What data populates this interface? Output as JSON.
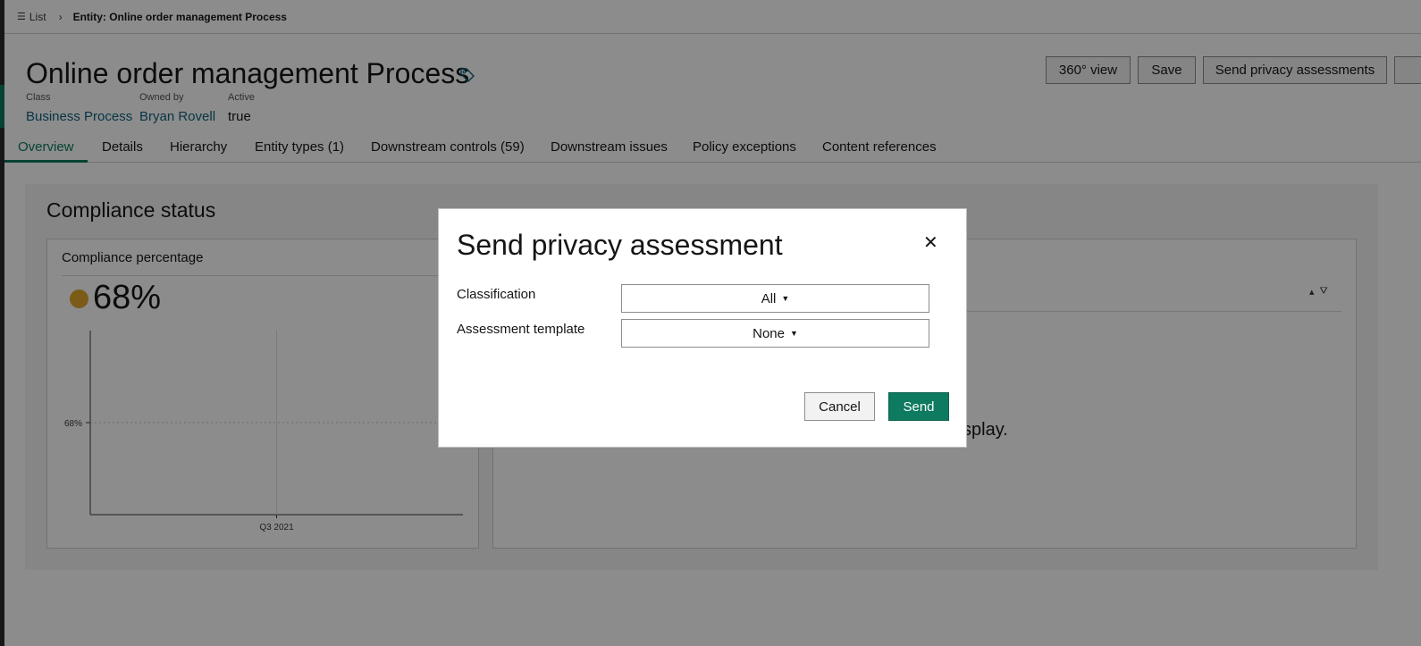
{
  "breadcrumb": {
    "list_label": "List",
    "current": "Entity: Online order management Process"
  },
  "header": {
    "title": "Online order management Process",
    "meta": {
      "class_label": "Class",
      "class_value": "Business Process",
      "owner_label": "Owned by",
      "owner_value": "Bryan Rovell",
      "active_label": "Active",
      "active_value": "true"
    },
    "buttons": {
      "view360": "360° view",
      "save": "Save",
      "send_privacy": "Send privacy assessments"
    }
  },
  "tabs": [
    {
      "label": "Overview",
      "active": true
    },
    {
      "label": "Details"
    },
    {
      "label": "Hierarchy"
    },
    {
      "label": "Entity types (1)"
    },
    {
      "label": "Downstream controls (59)"
    },
    {
      "label": "Downstream issues"
    },
    {
      "label": "Policy exceptions"
    },
    {
      "label": "Content references"
    }
  ],
  "compliance": {
    "section_title": "Compliance status",
    "card_title": "Compliance percentage",
    "percentage": "68%",
    "status_color": "#e0a72b",
    "no_data_text": "splay."
  },
  "chart_data": {
    "type": "line",
    "categories": [
      "Q3 2021"
    ],
    "series": [
      {
        "values": [
          68
        ]
      }
    ],
    "yticks": [
      "68%"
    ],
    "xlabel": "",
    "ylabel": "",
    "grid": true
  },
  "modal": {
    "title": "Send privacy assessment",
    "fields": {
      "classification_label": "Classification",
      "classification_value": "All",
      "template_label": "Assessment template",
      "template_value": "None"
    },
    "cancel_label": "Cancel",
    "send_label": "Send"
  },
  "colors": {
    "accent": "#0e7a5f",
    "link": "#0f6280",
    "status": "#e0a72b"
  }
}
